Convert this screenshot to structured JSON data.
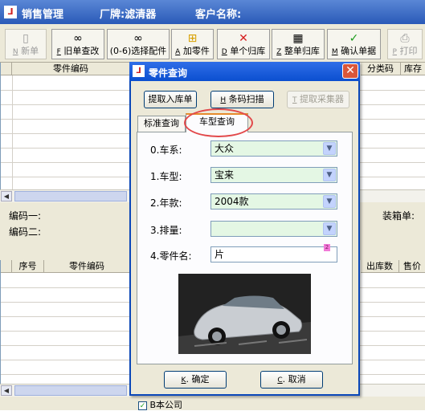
{
  "main_window": {
    "title": "销售管理",
    "factory_label": "厂牌:滤清器",
    "customer_label": "客户名称:"
  },
  "toolbar": {
    "buttons": [
      {
        "key": "N",
        "label": "新单",
        "icon": "document-icon"
      },
      {
        "key": "F",
        "label": "旧单查改",
        "icon": "binoculars-icon"
      },
      {
        "key": "",
        "label": "(0-6)选择配件",
        "icon": "binoculars-icon"
      },
      {
        "key": "A",
        "label": "加零件",
        "icon": "add-part-icon"
      },
      {
        "key": "D",
        "label": "单个归库",
        "icon": "red-x-icon"
      },
      {
        "key": "Z",
        "label": "整单归库",
        "icon": "calculator-icon"
      },
      {
        "key": "M",
        "label": "确认单据",
        "icon": "checkmark-icon"
      },
      {
        "key": "P",
        "label": "打印",
        "icon": "printer-icon"
      }
    ]
  },
  "top_grid": {
    "headers": [
      "零件编码",
      "分类码",
      "库存"
    ]
  },
  "mid_panel": {
    "code1_label": "编码一:",
    "code2_label": "编码二:",
    "box_label": "装箱单:"
  },
  "bottom_grid": {
    "headers": [
      "序号",
      "零件编码",
      "出库数",
      "售价"
    ]
  },
  "status": {
    "company_checkbox_label": "B本公司",
    "company_checked": true
  },
  "dialog": {
    "title": "零件查询",
    "close_glyph": "✕",
    "buttons": {
      "extract_inbound": "提取入库单",
      "barcode_scan": {
        "key": "H",
        "label": "条码扫描"
      },
      "extract_collector": {
        "key": "T",
        "label": "提取采集器"
      }
    },
    "tabs": [
      "标准查询",
      "车型查询"
    ],
    "active_tab": "车型查询",
    "fields": [
      {
        "label": "0.车系:",
        "value": "大众",
        "type": "combo",
        "bg": "#e4f7e4"
      },
      {
        "label": "1.车型:",
        "value": "宝来",
        "type": "combo",
        "bg": "#e4f7e4"
      },
      {
        "label": "2.年款:",
        "value": "2004款",
        "type": "combo",
        "bg": "#e4f7e4"
      },
      {
        "label": "3.排量:",
        "value": "",
        "type": "combo",
        "bg": "#e4f7e4"
      },
      {
        "label": "4.零件名:",
        "value": "片",
        "type": "text",
        "bg": "#ffffff"
      }
    ],
    "marker_text": "2",
    "ok": {
      "key": "K",
      "label": "确定"
    },
    "cancel": {
      "key": "C",
      "label": "取消"
    }
  },
  "colors": {
    "title_bar": "#2a5ab8",
    "dialog_title": "#0b4fd0",
    "close_button": "#d9563a",
    "combo_bg": "#e4f7e4",
    "tab_highlight_ring": "#e2484a"
  }
}
